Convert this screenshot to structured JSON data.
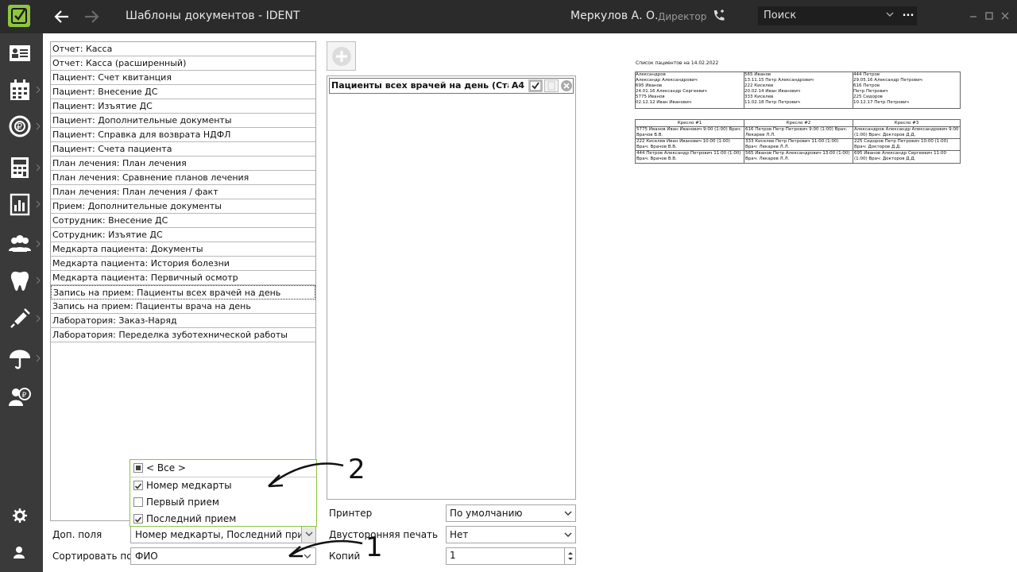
{
  "header": {
    "title": "Шаблоны документов  -  IDENT",
    "user": "Меркулов А. О.",
    "role": "Директор",
    "search_placeholder": "Поиск",
    "more": "..."
  },
  "sidebar": {
    "icons": [
      "id-card-icon",
      "calendar-icon",
      "payment-icon",
      "calculator-icon",
      "reports-icon",
      "people-icon",
      "tooth-icon",
      "syringe-icon",
      "umbrella-icon",
      "patient-payment-icon"
    ],
    "bottom_icons": [
      "gear-icon",
      "user-icon"
    ]
  },
  "templates": [
    "Отчет: Касса",
    "Отчет: Касса (расширенный)",
    "Пациент: Счет квитанция",
    "Пациент: Внесение ДС",
    "Пациент: Изъятие ДС",
    "Пациент: Дополнительные документы",
    "Пациент: Справка для возврата НДФЛ",
    "Пациент: Счета пациента",
    "План лечения: План лечения",
    "План лечения: Сравнение планов лечения",
    "План лечения: План лечения / факт",
    "Прием: Дополнительные документы",
    "Сотрудник: Внесение ДС",
    "Сотрудник: Изъятие ДС",
    "Медкарта пациента: Документы",
    "Медкарта пациента: История болезни",
    "Медкарта пациента: Первичный осмотр",
    "Запись на прием: Пациенты всех врачей на день",
    "Запись на прием: Пациенты врача на день",
    "Лаборатория: Заказ-Наряд",
    "Лаборатория: Переделка зуботехнической работы"
  ],
  "selected_index": 17,
  "extra_fields": {
    "label": "Доп. поля",
    "value": "Номер медкарты, Последний прием",
    "options": [
      {
        "label": "< Все >",
        "state": "partial"
      },
      {
        "label": "Номер медкарты",
        "state": "checked"
      },
      {
        "label": "Первый прием",
        "state": "unchecked"
      },
      {
        "label": "Последний прием",
        "state": "checked"
      }
    ]
  },
  "sort": {
    "label": "Сортировать по",
    "value": "ФИО"
  },
  "middle": {
    "row_name": "Пациенты всех врачей на день (Стандарт)",
    "row_format": "A4"
  },
  "settings": {
    "printer_label": "Принтер",
    "printer_value": "По умолчанию",
    "duplex_label": "Двусторонняя печать",
    "duplex_value": "Нет",
    "copies_label": "Копий",
    "copies_value": "1"
  },
  "preview": {
    "title": "Список пациентов на 14.02.2022",
    "columns": [
      [
        "        Александров",
        "           Александр Александрович",
        "   695      Иванов",
        "24.01.16  Александр Сергеевич",
        "   5775     Иванов",
        "02.12.12  Иван Иванович"
      ],
      [
        "   565      Иванов",
        "13.11.15  Петр Александрович",
        "   222      Киселев",
        "20.02.14  Иван Иванович",
        "   333      Киселев",
        "11.02.18  Петр Петрович"
      ],
      [
        "   444      Петров",
        "29.05.16  Александр Петрович",
        "   616      Петров",
        "               Петр Петрович",
        "   225      Сидоров",
        "10.12.17  Петр Петрович"
      ]
    ],
    "chairs": [
      "Кресло #1",
      "Кресло #2",
      "Кресло #3"
    ],
    "cells": [
      [
        "5775 Иванов Иван Иванович 9:00 (1:00) Врач: Врачов В.В.",
        "222 Киселев Иван Иванович 10:00 (1:00) Врач: Врачов В.В.",
        "444 Петров Александр Петрович 11:00 (1:00) Врач: Врачов В.В."
      ],
      [
        "616 Петров Петр Петрович 9:00 (1:00) Врач: Лекарев Л.Л.",
        "333 Киселев Петр Петрович 11:00 (1:00) Врач: Лекарев Л.Л.",
        "565 Иванов Петр Александрович 13:00 (1:00) Врач: Лекарев Л.Л."
      ],
      [
        "Александров Александр Александрович 9:00 (1:00) Врач: Докторов Д.Д.",
        "225 Сидоров Петр Петрович 10:00 (1:00) Врач: Докторов Д.Д.",
        "695 Иванов Александр Сергеевич 11:00 (1:00) Врач: Докторов Д.Д."
      ]
    ]
  },
  "annotations": {
    "one": "1",
    "two": "2"
  }
}
